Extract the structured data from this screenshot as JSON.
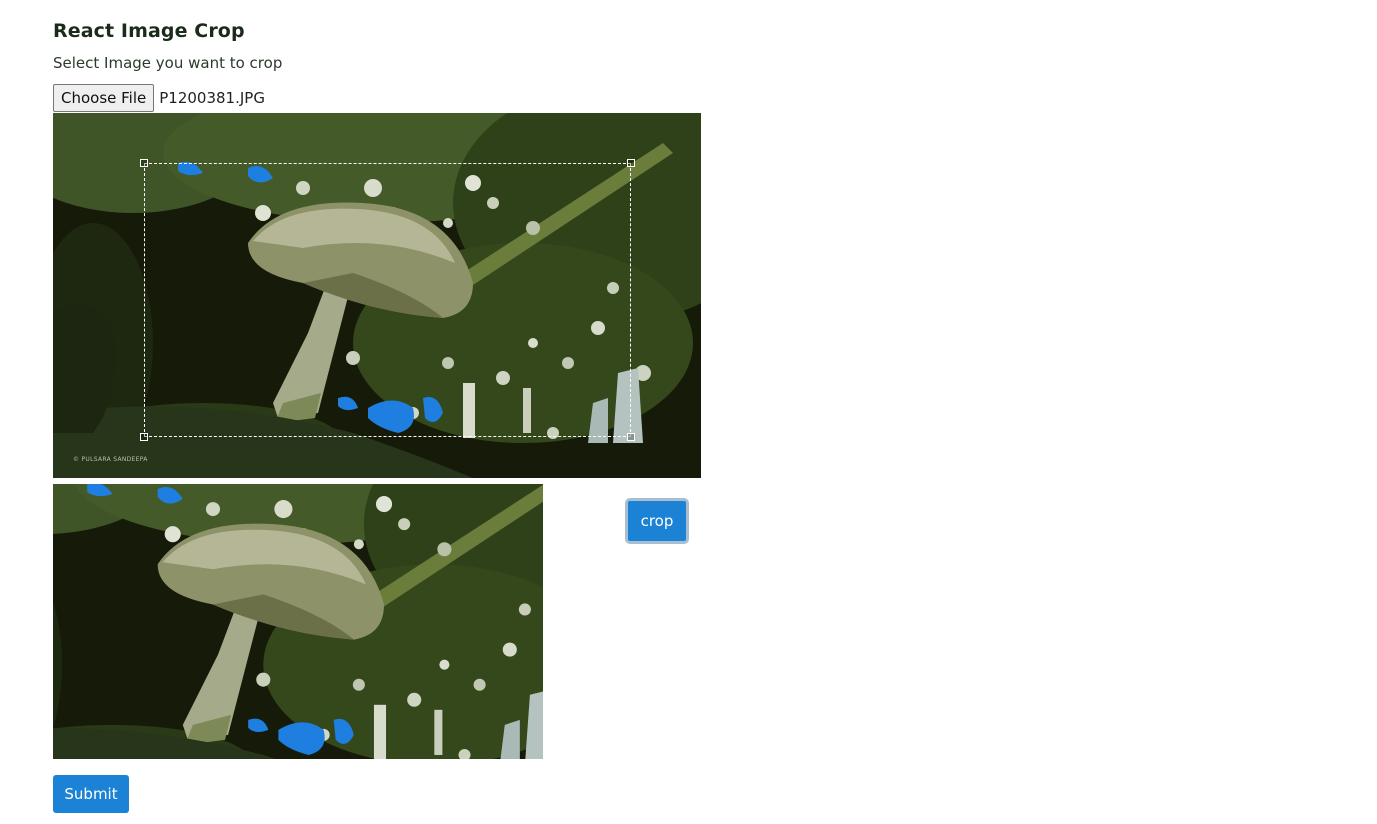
{
  "header": {
    "title": "React Image Crop",
    "subtitle": "Select Image you want to crop"
  },
  "file_input": {
    "button_label": "Choose File",
    "file_name": "P1200381.JPG"
  },
  "source_image": {
    "watermark": "© PULSARA SANDEEPA"
  },
  "actions": {
    "crop_label": "crop",
    "submit_label": "Submit"
  },
  "colors": {
    "button_blue": "#1b82d6",
    "image_dark": "#16190a"
  }
}
